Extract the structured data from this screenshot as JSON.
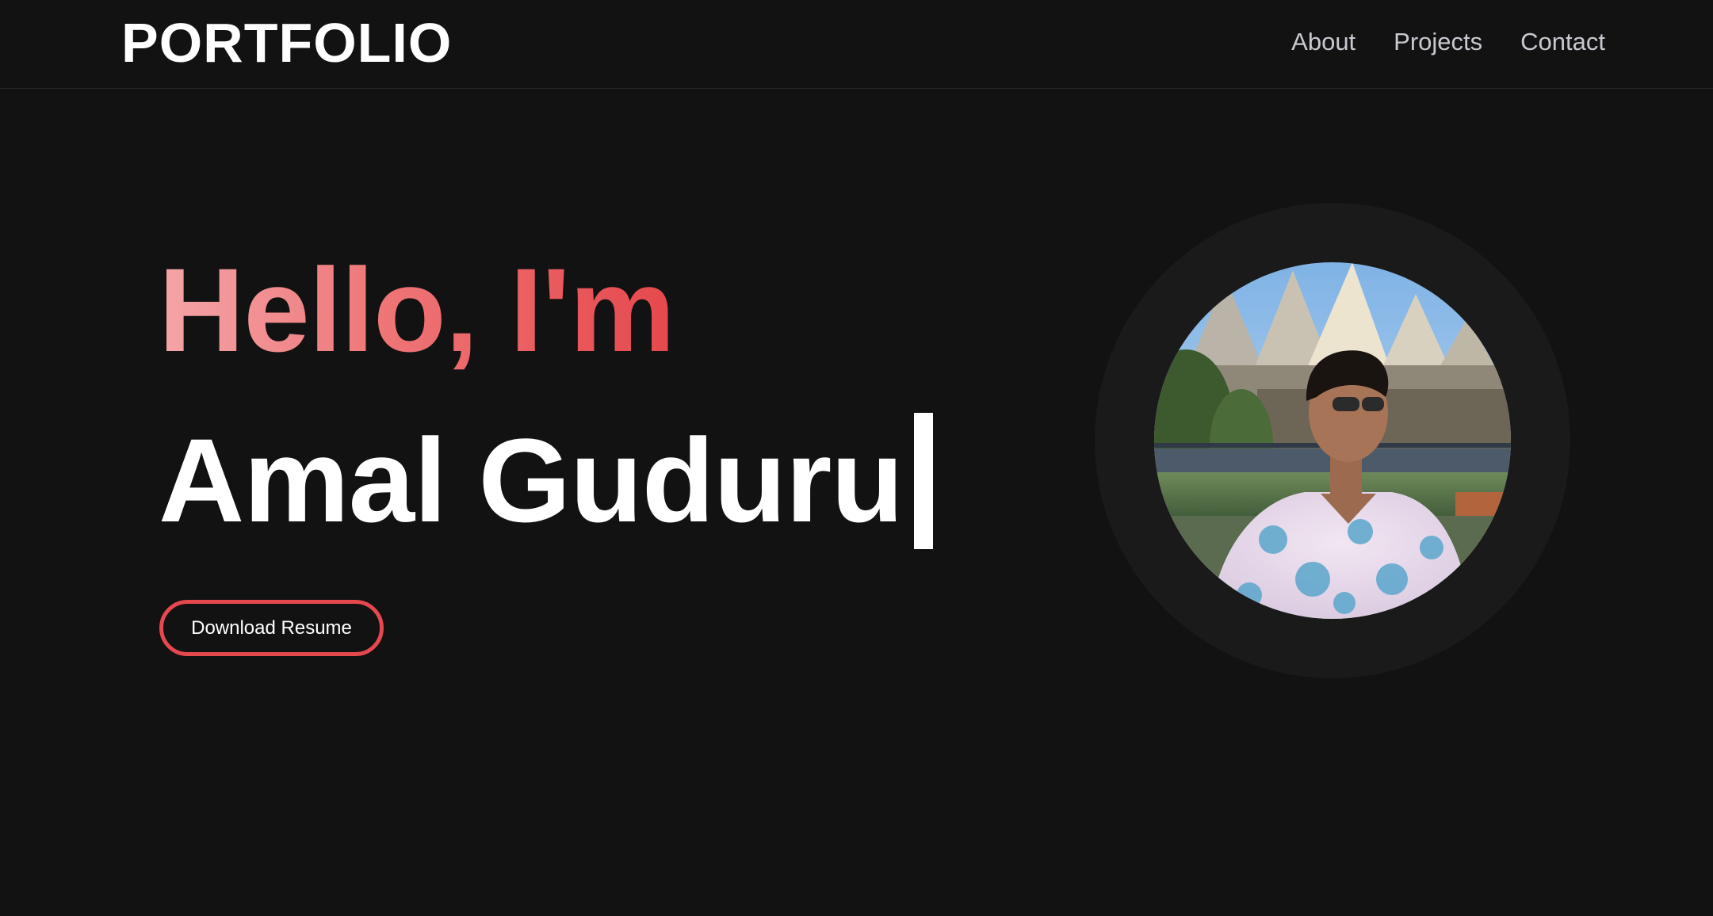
{
  "header": {
    "logo": "PORTFOLIO",
    "nav": [
      {
        "label": "About"
      },
      {
        "label": "Projects"
      },
      {
        "label": "Contact"
      }
    ]
  },
  "hero": {
    "greeting": "Hello, I'm",
    "name": "Amal Guduru",
    "resume_button": "Download Resume"
  },
  "colors": {
    "background": "#121212",
    "accent": "#e5484d",
    "accent_light": "#f4a5a8",
    "text": "#ffffff",
    "nav_text": "#c7c9cf"
  }
}
